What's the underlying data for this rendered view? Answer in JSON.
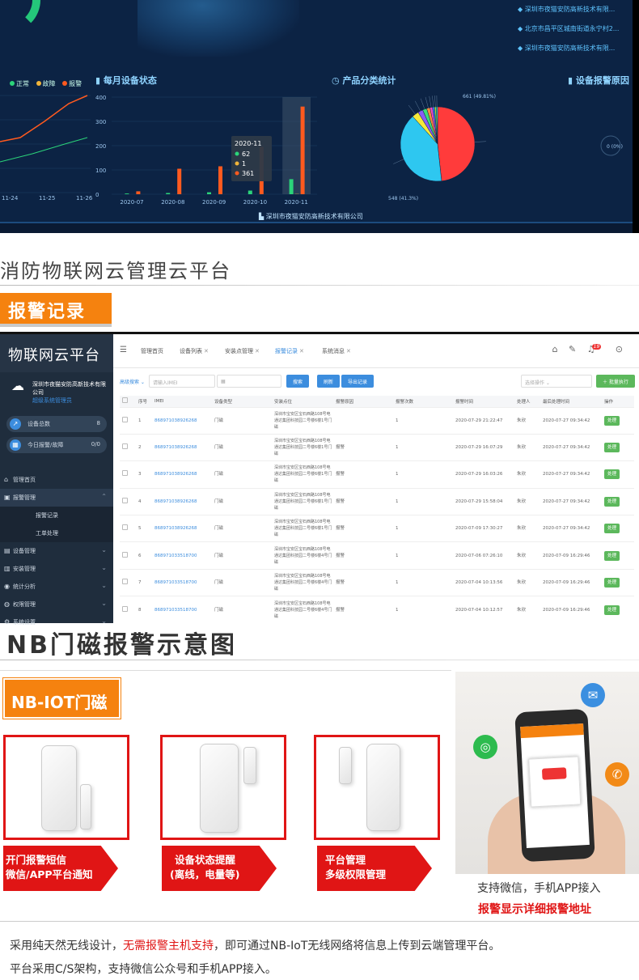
{
  "dashboard": {
    "companies": [
      "深圳市夜猫安防高新技术有限...",
      "北京市昌平区城南街道永宁村2...",
      "深圳市夜猫安防高新技术有限..."
    ],
    "monthly_title": "每月设备状态",
    "category_title": "产品分类统计",
    "reason_title": "设备报警原因",
    "legend": [
      {
        "label": "正常",
        "color": "#2bd47a"
      },
      {
        "label": "故障",
        "color": "#f0b43a"
      },
      {
        "label": "报警",
        "color": "#ff5a1f"
      }
    ],
    "footer": "深圳市夜猫安防高新技术有限公司",
    "tooltip": {
      "title": "2020-11",
      "values": [
        "62",
        "1",
        "361"
      ]
    },
    "pie_note_top": "661 (49.81%)",
    "pie_note_bottom": "548 (41.3%)",
    "right_note": "0 (0%)"
  },
  "chart_data": [
    {
      "type": "line",
      "x": [
        "11-24",
        "11-25",
        "11-26"
      ],
      "series": [
        {
          "name": "",
          "values": []
        }
      ]
    },
    {
      "type": "bar",
      "title": "每月设备状态",
      "categories": [
        "2020-07",
        "2020-08",
        "2020-09",
        "2020-10",
        "2020-11"
      ],
      "ylim": [
        0,
        400
      ],
      "yticks": [
        "0",
        "100",
        "200",
        "300",
        "400"
      ],
      "series": [
        {
          "name": "正常",
          "color": "#2bd47a",
          "values": [
            3,
            5,
            8,
            15,
            62
          ]
        },
        {
          "name": "故障",
          "color": "#f0b43a",
          "values": [
            0,
            0,
            0,
            0,
            1
          ]
        },
        {
          "name": "报警",
          "color": "#ff5a1f",
          "values": [
            12,
            105,
            115,
            195,
            361
          ]
        }
      ]
    },
    {
      "type": "pie",
      "title": "产品分类统计",
      "slices": [
        {
          "value": 661,
          "color": "#ff3b3b"
        },
        {
          "value": 548,
          "color": "#2ec7f0"
        },
        {
          "value": 40,
          "color": "#f5e93a"
        },
        {
          "value": 30,
          "color": "#8a5cf5"
        },
        {
          "value": 25,
          "color": "#3cdc7a"
        },
        {
          "value": 20,
          "color": "#ff8a3c"
        },
        {
          "value": 15,
          "color": "#f54cc8"
        },
        {
          "value": 12,
          "color": "#3c7af5"
        },
        {
          "value": 10,
          "color": "#9be83c"
        },
        {
          "value": 8,
          "color": "#35e0c9"
        }
      ]
    }
  ],
  "titles": {
    "cloud_platform": "消防物联网云管理云平台",
    "alarm_records": "报警记录",
    "nb_diagram": "NB门磁报警示意图",
    "nb_tab": "NB-IOT门磁"
  },
  "admin": {
    "logo": "物联网云平台",
    "company": "深圳市夜猫安防高新技术有限公司",
    "company_sub": "超级系统管理员",
    "stats": [
      {
        "label": "设备总数",
        "value": "8"
      },
      {
        "label": "今日报警/故障",
        "value": "0/0"
      }
    ],
    "menu": [
      {
        "label": "管理首页",
        "icon": "⌂",
        "chev": ""
      },
      {
        "label": "报警管理",
        "icon": "▣",
        "chev": "⌃",
        "active": true
      },
      {
        "label": "报警记录",
        "sub": true
      },
      {
        "label": "工单处理",
        "sub": true
      },
      {
        "label": "设备管理",
        "icon": "▤",
        "chev": "⌄"
      },
      {
        "label": "安装管理",
        "icon": "▥",
        "chev": "⌄"
      },
      {
        "label": "统计分析",
        "icon": "◉",
        "chev": "⌄"
      },
      {
        "label": "权限管理",
        "icon": "◍",
        "chev": "⌄"
      },
      {
        "label": "系统设置",
        "icon": "⚙",
        "chev": "⌄"
      }
    ],
    "tabs": [
      "管理首页",
      "设备列表",
      "安装点管理",
      "报警记录",
      "系统消息"
    ],
    "filter": {
      "search_type": "高级搜索",
      "imei_placeholder": "请输入IMEI",
      "date_placeholder": "",
      "search": "搜索",
      "refresh": "刷新",
      "export": "导出记录",
      "batch_placeholder": "选择操作",
      "batch_exec": "批量执行"
    },
    "columns": [
      "序号",
      "IMEI",
      "设备类型",
      "安装点位",
      "报警原因",
      "报警次数",
      "报警时间",
      "处理人",
      "最后处理时间",
      "操作"
    ],
    "rows": [
      {
        "no": "1",
        "imei": "868971038926268",
        "type": "门磁",
        "loc": "深圳市宝安区宝石西路108号电通达集团科技园二号楼6楼1号门磁",
        "reason": "",
        "count": "1",
        "time": "2020-07-29 21:22:47",
        "handler": "朱欣",
        "last": "2020-07-27 09:34:42",
        "op": "处理"
      },
      {
        "no": "2",
        "imei": "868971038926268",
        "type": "门磁",
        "loc": "深圳市宝安区宝石西路108号电通达集团科技园二号楼6楼1号门磁",
        "reason": "报警",
        "count": "1",
        "time": "2020-07-29 16:07:29",
        "handler": "朱欣",
        "last": "2020-07-27 09:34:42",
        "op": "处理"
      },
      {
        "no": "3",
        "imei": "868971038926268",
        "type": "门磁",
        "loc": "深圳市宝安区宝石西路108号电通达集团科技园二号楼6楼1号门磁",
        "reason": "报警",
        "count": "1",
        "time": "2020-07-29 16:03:26",
        "handler": "朱欣",
        "last": "2020-07-27 09:34:42",
        "op": "处理"
      },
      {
        "no": "4",
        "imei": "868971038926268",
        "type": "门磁",
        "loc": "深圳市宝安区宝石西路108号电通达集团科技园二号楼6楼1号门磁",
        "reason": "报警",
        "count": "1",
        "time": "2020-07-29 15:58:04",
        "handler": "朱欣",
        "last": "2020-07-27 09:34:42",
        "op": "处理"
      },
      {
        "no": "5",
        "imei": "868971038926268",
        "type": "门磁",
        "loc": "深圳市宝安区宝石西路108号电通达集团科技园二号楼6楼1号门磁",
        "reason": "报警",
        "count": "1",
        "time": "2020-07-09 17:30:27",
        "handler": "朱欣",
        "last": "2020-07-27 09:34:42",
        "op": "处理"
      },
      {
        "no": "6",
        "imei": "868971033518700",
        "type": "门磁",
        "loc": "深圳市宝安区宝石西路108号电通达集团科技园二号楼6楼4号门磁",
        "reason": "报警",
        "count": "1",
        "time": "2020-07-06 07:26:10",
        "handler": "朱欣",
        "last": "2020-07-09 16:29:46",
        "op": "处理"
      },
      {
        "no": "7",
        "imei": "868971033518700",
        "type": "门磁",
        "loc": "深圳市宝安区宝石西路108号电通达集团科技园二号楼6楼4号门磁",
        "reason": "报警",
        "count": "1",
        "time": "2020-07-04 10:13:56",
        "handler": "朱欣",
        "last": "2020-07-09 16:29:46",
        "op": "处理"
      },
      {
        "no": "8",
        "imei": "868971033518700",
        "type": "门磁",
        "loc": "深圳市宝安区宝石西路108号电通达集团科技园二号楼6楼4号门磁",
        "reason": "报警",
        "count": "1",
        "time": "2020-07-04 10:12:57",
        "handler": "朱欣",
        "last": "2020-07-09 16:29:46",
        "op": "处理"
      }
    ]
  },
  "features": [
    {
      "line1": "开门报警短信",
      "line2": "微信/APP平台通知"
    },
    {
      "line1": "设备状态提醒",
      "line2": "(离线，电量等)"
    },
    {
      "line1": "平台管理",
      "line2": "多级权限管理"
    }
  ],
  "captions": {
    "wechat": "支持微信，手机APP接入",
    "address": "报警显示详细报警地址"
  },
  "footer": {
    "line1_a": "采用纯天然无线设计，",
    "line1_b": "无需报警主机支持",
    "line1_c": "，即可通过NB-IoT无线网络将信息上传到云端管理平台。",
    "line2": "平台采用C/S架构，支持微信公众号和手机APP接入。"
  }
}
